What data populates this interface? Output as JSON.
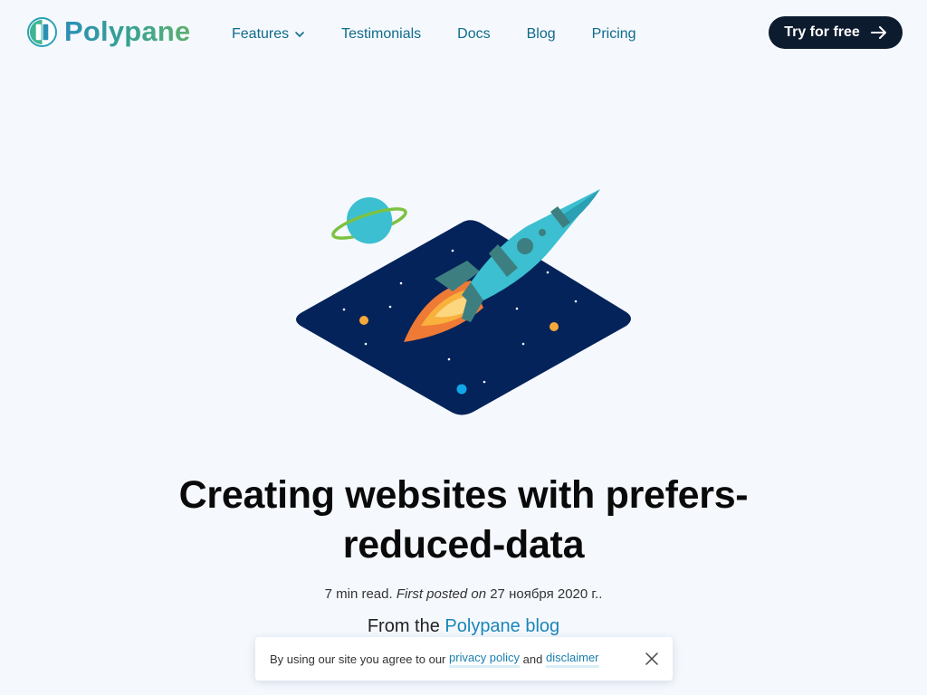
{
  "header": {
    "brand": "Polypane",
    "nav": {
      "features": "Features",
      "testimonials": "Testimonials",
      "docs": "Docs",
      "blog": "Blog",
      "pricing": "Pricing"
    },
    "cta_label": "Try for free"
  },
  "article": {
    "title": "Creating websites with prefers-reduced-data",
    "read_time": "7 min read.",
    "posted_label": "First posted on",
    "posted_date": "27 ноября 2020 г..",
    "from_prefix": "From the",
    "from_link": "Polypane blog"
  },
  "cookie_banner": {
    "text_before": "By using our site you agree to our",
    "privacy_link": "privacy policy",
    "and": "and",
    "disclaimer_link": "disclaimer"
  },
  "colors": {
    "background": "#f5f9fe",
    "accent": "#1a86b8",
    "cta_bg": "#0d1b2e",
    "space": "#04235a",
    "rocket": "#3cbfd0"
  },
  "icons": {
    "logo": "polypane-logo-icon",
    "features_chevron": "chevron-down-icon",
    "cta_arrow": "arrow-right-icon",
    "cookie_close": "close-icon"
  }
}
